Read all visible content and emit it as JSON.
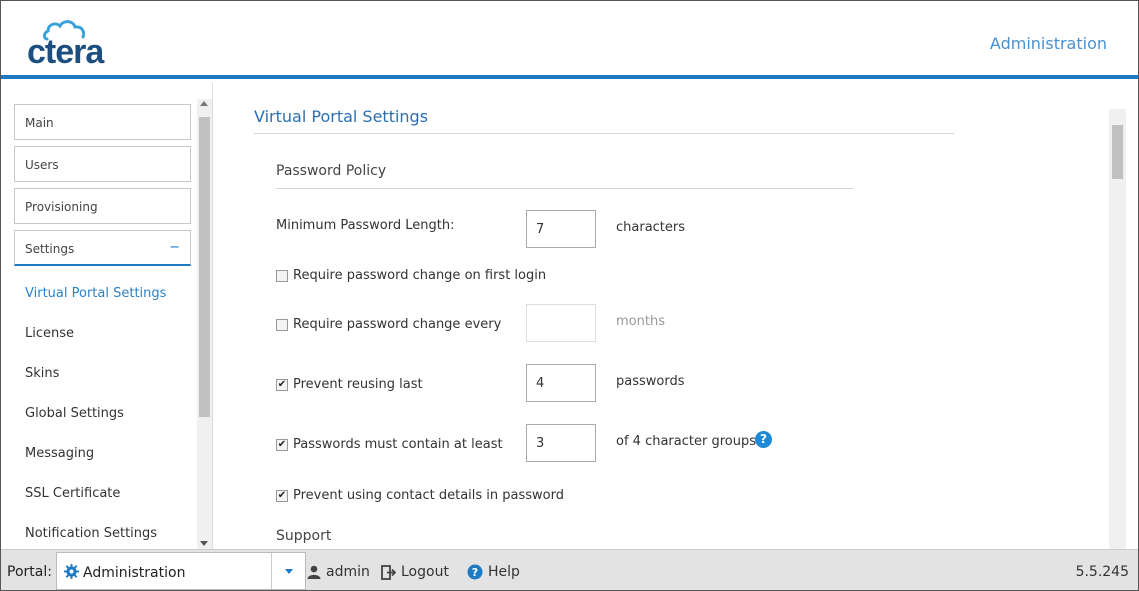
{
  "header": {
    "logo_text": "ctera",
    "section_title": "Administration"
  },
  "sidebar": {
    "boxes": [
      {
        "label": "Main"
      },
      {
        "label": "Users"
      },
      {
        "label": "Provisioning"
      },
      {
        "label": "Settings",
        "toggle": "−"
      }
    ],
    "sub_items": [
      {
        "label": "Virtual Portal Settings",
        "selected": true
      },
      {
        "label": "License"
      },
      {
        "label": "Skins"
      },
      {
        "label": "Global Settings"
      },
      {
        "label": "Messaging"
      },
      {
        "label": "SSL Certificate"
      },
      {
        "label": "Notification Settings"
      }
    ]
  },
  "main": {
    "title": "Virtual Portal Settings",
    "password_policy": {
      "title": "Password Policy",
      "min_length_label": "Minimum Password Length:",
      "min_length_value": "7",
      "min_length_unit": "characters",
      "first_login_label": "Require password change on first login",
      "first_login_checked": false,
      "change_every_label": "Require password change every",
      "change_every_checked": false,
      "change_every_value": "",
      "change_every_unit": "months",
      "reuse_label": "Prevent reusing last",
      "reuse_checked": true,
      "reuse_value": "4",
      "reuse_unit": "passwords",
      "groups_label": "Passwords must contain at least",
      "groups_checked": true,
      "groups_value": "3",
      "groups_unit": "of 4 character groups",
      "contact_label": "Prevent using contact details in password",
      "contact_checked": true,
      "check_glyph": "✔"
    },
    "support_title": "Support"
  },
  "footer": {
    "portal_label": "Portal:",
    "portal_value": "Administration",
    "user": "admin",
    "logout": "Logout",
    "help": "Help",
    "version": "5.5.245"
  },
  "colors": {
    "accent": "#1f7ac4",
    "link": "#2f80c4",
    "logo": "#1c4f80",
    "help_icon": "#1f8ad6"
  }
}
